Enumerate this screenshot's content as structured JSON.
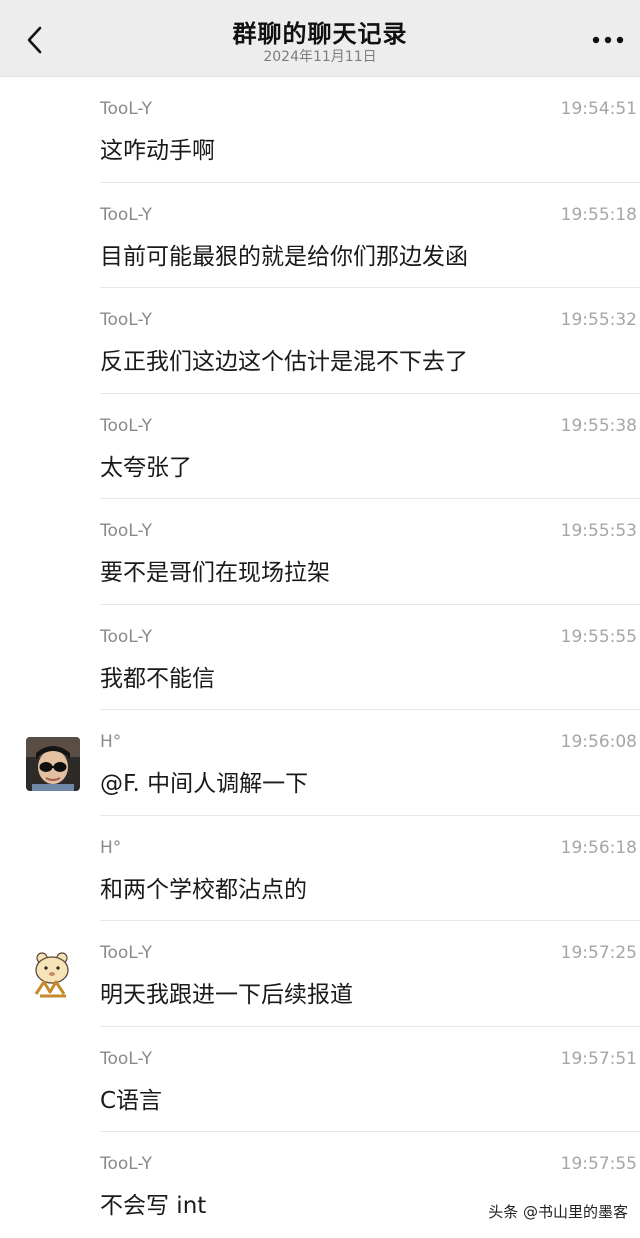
{
  "header": {
    "title": "群聊的聊天记录",
    "date": "2024年11月11日",
    "back_icon": "chevron-left-icon",
    "more_icon": "ellipsis-icon"
  },
  "messages": [
    {
      "sender": "TooL-Y",
      "time": "19:54:51",
      "text": "这咋动手啊"
    },
    {
      "sender": "TooL-Y",
      "time": "19:55:18",
      "text": "目前可能最狠的就是给你们那边发函"
    },
    {
      "sender": "TooL-Y",
      "time": "19:55:32",
      "text": "反正我们这边这个估计是混不下去了"
    },
    {
      "sender": "TooL-Y",
      "time": "19:55:38",
      "text": "太夸张了"
    },
    {
      "sender": "TooL-Y",
      "time": "19:55:53",
      "text": "要不是哥们在现场拉架"
    },
    {
      "sender": "TooL-Y",
      "time": "19:55:55",
      "text": "我都不能信"
    },
    {
      "sender": "H°",
      "time": "19:56:08",
      "text": "@F. 中间人调解一下"
    },
    {
      "sender": "H°",
      "time": "19:56:18",
      "text": "和两个学校都沾点的"
    },
    {
      "sender": "TooL-Y",
      "time": "19:57:25",
      "text": "明天我跟进一下后续报道"
    },
    {
      "sender": "TooL-Y",
      "time": "19:57:51",
      "text": "C语言"
    },
    {
      "sender": "TooL-Y",
      "time": "19:57:55",
      "text": "不会写 int"
    }
  ],
  "watermark": "头条 @书山里的墨客"
}
